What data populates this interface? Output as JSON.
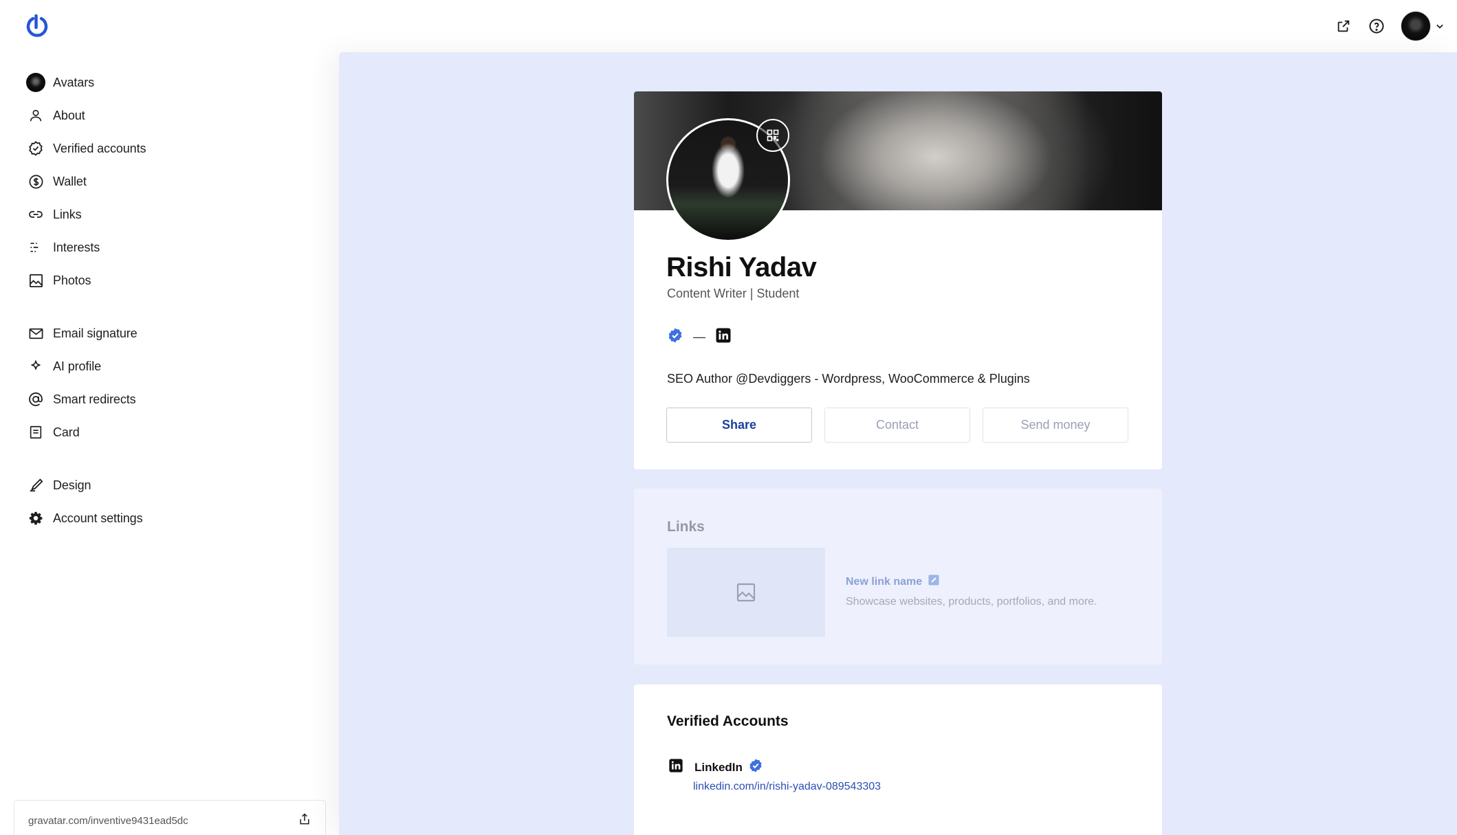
{
  "sidebar": {
    "groups": [
      [
        {
          "label": "Avatars",
          "icon": "avatar-icon"
        },
        {
          "label": "About",
          "icon": "person-icon"
        },
        {
          "label": "Verified accounts",
          "icon": "verified-badge-icon"
        },
        {
          "label": "Wallet",
          "icon": "dollar-icon"
        },
        {
          "label": "Links",
          "icon": "link-icon"
        },
        {
          "label": "Interests",
          "icon": "interests-icon"
        },
        {
          "label": "Photos",
          "icon": "image-icon"
        }
      ],
      [
        {
          "label": "Email signature",
          "icon": "mail-icon"
        },
        {
          "label": "AI profile",
          "icon": "sparkle-icon"
        },
        {
          "label": "Smart redirects",
          "icon": "at-icon"
        },
        {
          "label": "Card",
          "icon": "card-icon"
        }
      ],
      [
        {
          "label": "Design",
          "icon": "brush-icon"
        },
        {
          "label": "Account settings",
          "icon": "gear-icon"
        }
      ]
    ],
    "profile_url": "gravatar.com/inventive9431ead5dc"
  },
  "profile": {
    "name": "Rishi Yadav",
    "job_title": "Content Writer | Student",
    "badge_separator": "—",
    "bio": "SEO Author @Devdiggers - Wordpress, WooCommerce & Plugins",
    "actions": {
      "share": "Share",
      "contact": "Contact",
      "send_money": "Send money"
    }
  },
  "links_section": {
    "title": "Links",
    "new_link_name": "New link name",
    "description": "Showcase websites, products, portfolios, and more."
  },
  "verified_section": {
    "title": "Verified Accounts",
    "account_name": "LinkedIn",
    "account_url": "linkedin.com/in/rishi-yadav-089543303"
  },
  "colors": {
    "brand": "#3858e9",
    "main_background": "#e4e9fb",
    "link": "#2b4fb3",
    "verified": "#3d6fdf"
  }
}
